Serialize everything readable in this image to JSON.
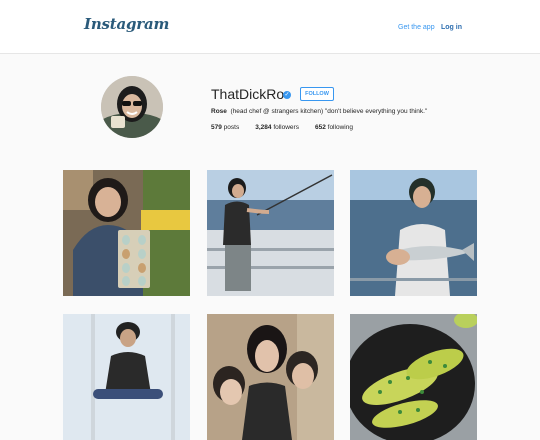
{
  "header": {
    "logo": "Instagram",
    "get_app": "Get the app",
    "login": "Log in"
  },
  "profile": {
    "username": "ThatDickRo",
    "follow_label": "FOLLOW",
    "name": "Rose",
    "bio": "(head chef @ strangers kitchen) \"don't believe everything you think.\"",
    "posts_count": "579",
    "posts_label": "posts",
    "followers_count": "3,284",
    "followers_label": "followers",
    "following_count": "652",
    "following_label": "following"
  },
  "icons": [
    "verified-badge-icon"
  ]
}
